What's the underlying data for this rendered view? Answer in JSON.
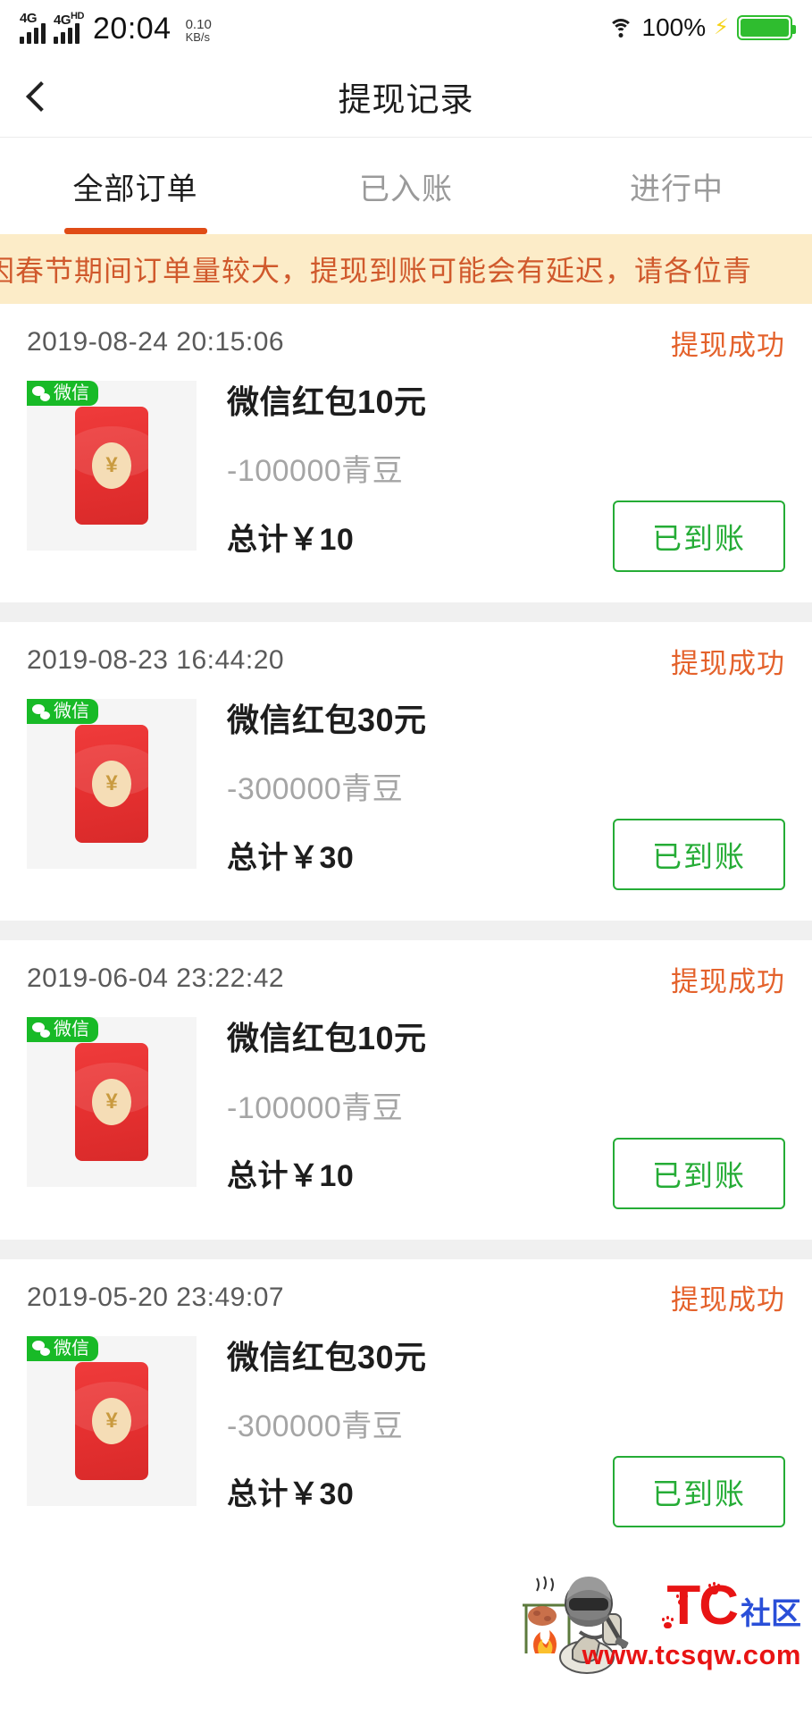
{
  "status_bar": {
    "network_label_1": "4G",
    "network_label_2": "4G",
    "network_label_2_sup": "HD",
    "time": "20:04",
    "speed_value": "0.10",
    "speed_unit": "KB/s",
    "battery_percent": "100%",
    "wifi_icon": "wifi-icon",
    "charging_icon": "lightning-bolt-icon",
    "battery_color": "#2fbd2f"
  },
  "navbar": {
    "back_icon": "chevron-left-icon",
    "title": "提现记录"
  },
  "tabs": {
    "active_index": 0,
    "accent_color": "#e04c16",
    "items": [
      {
        "label": "全部订单"
      },
      {
        "label": "已入账"
      },
      {
        "label": "进行中"
      }
    ]
  },
  "notice": {
    "text": "因春节期间订单量较大，提现到账可能会有延迟，请各位青",
    "background": "#fcecc8",
    "color": "#d0592c"
  },
  "records": [
    {
      "date": "2019-08-24 20:15:06",
      "status": "提现成功",
      "badge": "微信",
      "thumb_icon": "red-envelope-icon",
      "coin_symbol": "¥",
      "title": "微信红包10元",
      "beans": "-100000青豆",
      "total": "总计￥10",
      "action": "已到账"
    },
    {
      "date": "2019-08-23 16:44:20",
      "status": "提现成功",
      "badge": "微信",
      "thumb_icon": "red-envelope-icon",
      "coin_symbol": "¥",
      "title": "微信红包30元",
      "beans": "-300000青豆",
      "total": "总计￥30",
      "action": "已到账"
    },
    {
      "date": "2019-06-04 23:22:42",
      "status": "提现成功",
      "badge": "微信",
      "thumb_icon": "red-envelope-icon",
      "coin_symbol": "¥",
      "title": "微信红包10元",
      "beans": "-100000青豆",
      "total": "总计￥10",
      "action": "已到账"
    },
    {
      "date": "2019-05-20 23:49:07",
      "status": "提现成功",
      "badge": "微信",
      "thumb_icon": "red-envelope-icon",
      "coin_symbol": "¥",
      "title": "微信红包30元",
      "beans": "-300000青豆",
      "total": "总计￥30",
      "action": "已到账"
    }
  ],
  "watermark": {
    "logo_primary": "TC",
    "logo_secondary": "社区",
    "url": "www.tcsqw.com",
    "figure_icon": "campfire-soldier-icon",
    "primary_color": "#e81414",
    "secondary_color": "#2a4fd8"
  }
}
